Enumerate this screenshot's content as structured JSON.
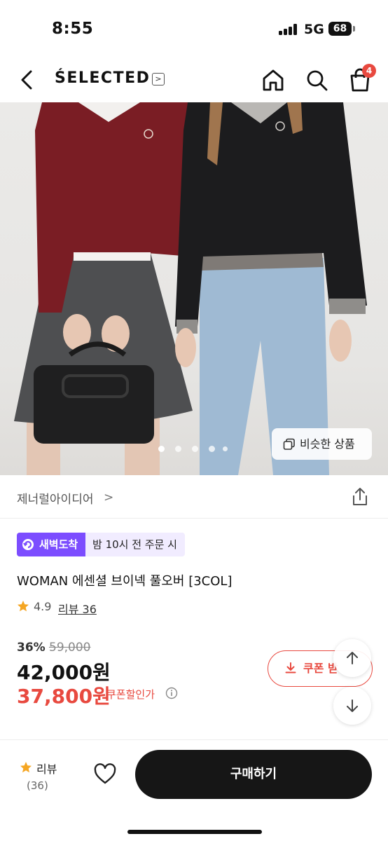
{
  "status_bar": {
    "time": "8:55",
    "network": "5G",
    "battery": "68"
  },
  "nav": {
    "brand": "ŚELECTED",
    "brand_arrow": ">",
    "cart_count": "4"
  },
  "hero": {
    "image_count": 5,
    "active_index": 0,
    "similar_label": "비슷한 상품"
  },
  "store": {
    "name": "제너럴아이디어",
    "chevron": ">"
  },
  "delivery": {
    "badge": "새벽도착",
    "note": "밤 10시 전 주문 시"
  },
  "product": {
    "title": "WOMAN 에센셜 브이넥 풀오버 [3COL]",
    "rating": "4.9",
    "review_link": "리뷰 36"
  },
  "price": {
    "discount_rate": "36%",
    "original": "59,000",
    "sale": "42,000원",
    "coupon_price": "37,800원",
    "coupon_label": "쿠폰할인가"
  },
  "coupon_button": {
    "label": "쿠폰 받"
  },
  "bottom_bar": {
    "review_label": "리뷰",
    "review_count": "(36)",
    "buy_label": "구매하기"
  },
  "colors": {
    "accent": "#e8493f",
    "purple": "#7c4dff",
    "dark": "#161616",
    "star": "#f5a623"
  }
}
